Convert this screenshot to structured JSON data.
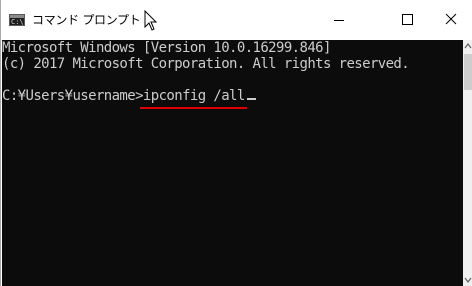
{
  "window": {
    "title": "コマンド プロンプト",
    "icon": "cmd-icon",
    "controls": {
      "minimize": "—",
      "maximize": "☐",
      "close": "✕"
    }
  },
  "console": {
    "lines": [
      "Microsoft Windows [Version 10.0.16299.846]",
      "(c) 2017 Microsoft Corporation. All rights reserved."
    ],
    "prompt": "C:¥Users¥username>",
    "command": "ipconfig /all"
  },
  "colors": {
    "console_bg": "#0c0c0c",
    "console_text": "#cccccc",
    "underline": "#e00000"
  }
}
